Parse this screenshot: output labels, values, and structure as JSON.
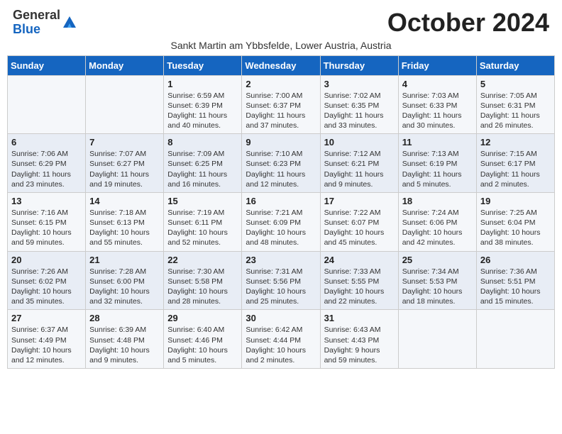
{
  "header": {
    "logo_general": "General",
    "logo_blue": "Blue",
    "month_title": "October 2024",
    "subtitle": "Sankt Martin am Ybbsfelde, Lower Austria, Austria"
  },
  "days_of_week": [
    "Sunday",
    "Monday",
    "Tuesday",
    "Wednesday",
    "Thursday",
    "Friday",
    "Saturday"
  ],
  "weeks": [
    [
      {
        "day": "",
        "sunrise": "",
        "sunset": "",
        "daylight": ""
      },
      {
        "day": "",
        "sunrise": "",
        "sunset": "",
        "daylight": ""
      },
      {
        "day": "1",
        "sunrise": "Sunrise: 6:59 AM",
        "sunset": "Sunset: 6:39 PM",
        "daylight": "Daylight: 11 hours and 40 minutes."
      },
      {
        "day": "2",
        "sunrise": "Sunrise: 7:00 AM",
        "sunset": "Sunset: 6:37 PM",
        "daylight": "Daylight: 11 hours and 37 minutes."
      },
      {
        "day": "3",
        "sunrise": "Sunrise: 7:02 AM",
        "sunset": "Sunset: 6:35 PM",
        "daylight": "Daylight: 11 hours and 33 minutes."
      },
      {
        "day": "4",
        "sunrise": "Sunrise: 7:03 AM",
        "sunset": "Sunset: 6:33 PM",
        "daylight": "Daylight: 11 hours and 30 minutes."
      },
      {
        "day": "5",
        "sunrise": "Sunrise: 7:05 AM",
        "sunset": "Sunset: 6:31 PM",
        "daylight": "Daylight: 11 hours and 26 minutes."
      }
    ],
    [
      {
        "day": "6",
        "sunrise": "Sunrise: 7:06 AM",
        "sunset": "Sunset: 6:29 PM",
        "daylight": "Daylight: 11 hours and 23 minutes."
      },
      {
        "day": "7",
        "sunrise": "Sunrise: 7:07 AM",
        "sunset": "Sunset: 6:27 PM",
        "daylight": "Daylight: 11 hours and 19 minutes."
      },
      {
        "day": "8",
        "sunrise": "Sunrise: 7:09 AM",
        "sunset": "Sunset: 6:25 PM",
        "daylight": "Daylight: 11 hours and 16 minutes."
      },
      {
        "day": "9",
        "sunrise": "Sunrise: 7:10 AM",
        "sunset": "Sunset: 6:23 PM",
        "daylight": "Daylight: 11 hours and 12 minutes."
      },
      {
        "day": "10",
        "sunrise": "Sunrise: 7:12 AM",
        "sunset": "Sunset: 6:21 PM",
        "daylight": "Daylight: 11 hours and 9 minutes."
      },
      {
        "day": "11",
        "sunrise": "Sunrise: 7:13 AM",
        "sunset": "Sunset: 6:19 PM",
        "daylight": "Daylight: 11 hours and 5 minutes."
      },
      {
        "day": "12",
        "sunrise": "Sunrise: 7:15 AM",
        "sunset": "Sunset: 6:17 PM",
        "daylight": "Daylight: 11 hours and 2 minutes."
      }
    ],
    [
      {
        "day": "13",
        "sunrise": "Sunrise: 7:16 AM",
        "sunset": "Sunset: 6:15 PM",
        "daylight": "Daylight: 10 hours and 59 minutes."
      },
      {
        "day": "14",
        "sunrise": "Sunrise: 7:18 AM",
        "sunset": "Sunset: 6:13 PM",
        "daylight": "Daylight: 10 hours and 55 minutes."
      },
      {
        "day": "15",
        "sunrise": "Sunrise: 7:19 AM",
        "sunset": "Sunset: 6:11 PM",
        "daylight": "Daylight: 10 hours and 52 minutes."
      },
      {
        "day": "16",
        "sunrise": "Sunrise: 7:21 AM",
        "sunset": "Sunset: 6:09 PM",
        "daylight": "Daylight: 10 hours and 48 minutes."
      },
      {
        "day": "17",
        "sunrise": "Sunrise: 7:22 AM",
        "sunset": "Sunset: 6:07 PM",
        "daylight": "Daylight: 10 hours and 45 minutes."
      },
      {
        "day": "18",
        "sunrise": "Sunrise: 7:24 AM",
        "sunset": "Sunset: 6:06 PM",
        "daylight": "Daylight: 10 hours and 42 minutes."
      },
      {
        "day": "19",
        "sunrise": "Sunrise: 7:25 AM",
        "sunset": "Sunset: 6:04 PM",
        "daylight": "Daylight: 10 hours and 38 minutes."
      }
    ],
    [
      {
        "day": "20",
        "sunrise": "Sunrise: 7:26 AM",
        "sunset": "Sunset: 6:02 PM",
        "daylight": "Daylight: 10 hours and 35 minutes."
      },
      {
        "day": "21",
        "sunrise": "Sunrise: 7:28 AM",
        "sunset": "Sunset: 6:00 PM",
        "daylight": "Daylight: 10 hours and 32 minutes."
      },
      {
        "day": "22",
        "sunrise": "Sunrise: 7:30 AM",
        "sunset": "Sunset: 5:58 PM",
        "daylight": "Daylight: 10 hours and 28 minutes."
      },
      {
        "day": "23",
        "sunrise": "Sunrise: 7:31 AM",
        "sunset": "Sunset: 5:56 PM",
        "daylight": "Daylight: 10 hours and 25 minutes."
      },
      {
        "day": "24",
        "sunrise": "Sunrise: 7:33 AM",
        "sunset": "Sunset: 5:55 PM",
        "daylight": "Daylight: 10 hours and 22 minutes."
      },
      {
        "day": "25",
        "sunrise": "Sunrise: 7:34 AM",
        "sunset": "Sunset: 5:53 PM",
        "daylight": "Daylight: 10 hours and 18 minutes."
      },
      {
        "day": "26",
        "sunrise": "Sunrise: 7:36 AM",
        "sunset": "Sunset: 5:51 PM",
        "daylight": "Daylight: 10 hours and 15 minutes."
      }
    ],
    [
      {
        "day": "27",
        "sunrise": "Sunrise: 6:37 AM",
        "sunset": "Sunset: 4:49 PM",
        "daylight": "Daylight: 10 hours and 12 minutes."
      },
      {
        "day": "28",
        "sunrise": "Sunrise: 6:39 AM",
        "sunset": "Sunset: 4:48 PM",
        "daylight": "Daylight: 10 hours and 9 minutes."
      },
      {
        "day": "29",
        "sunrise": "Sunrise: 6:40 AM",
        "sunset": "Sunset: 4:46 PM",
        "daylight": "Daylight: 10 hours and 5 minutes."
      },
      {
        "day": "30",
        "sunrise": "Sunrise: 6:42 AM",
        "sunset": "Sunset: 4:44 PM",
        "daylight": "Daylight: 10 hours and 2 minutes."
      },
      {
        "day": "31",
        "sunrise": "Sunrise: 6:43 AM",
        "sunset": "Sunset: 4:43 PM",
        "daylight": "Daylight: 9 hours and 59 minutes."
      },
      {
        "day": "",
        "sunrise": "",
        "sunset": "",
        "daylight": ""
      },
      {
        "day": "",
        "sunrise": "",
        "sunset": "",
        "daylight": ""
      }
    ]
  ]
}
